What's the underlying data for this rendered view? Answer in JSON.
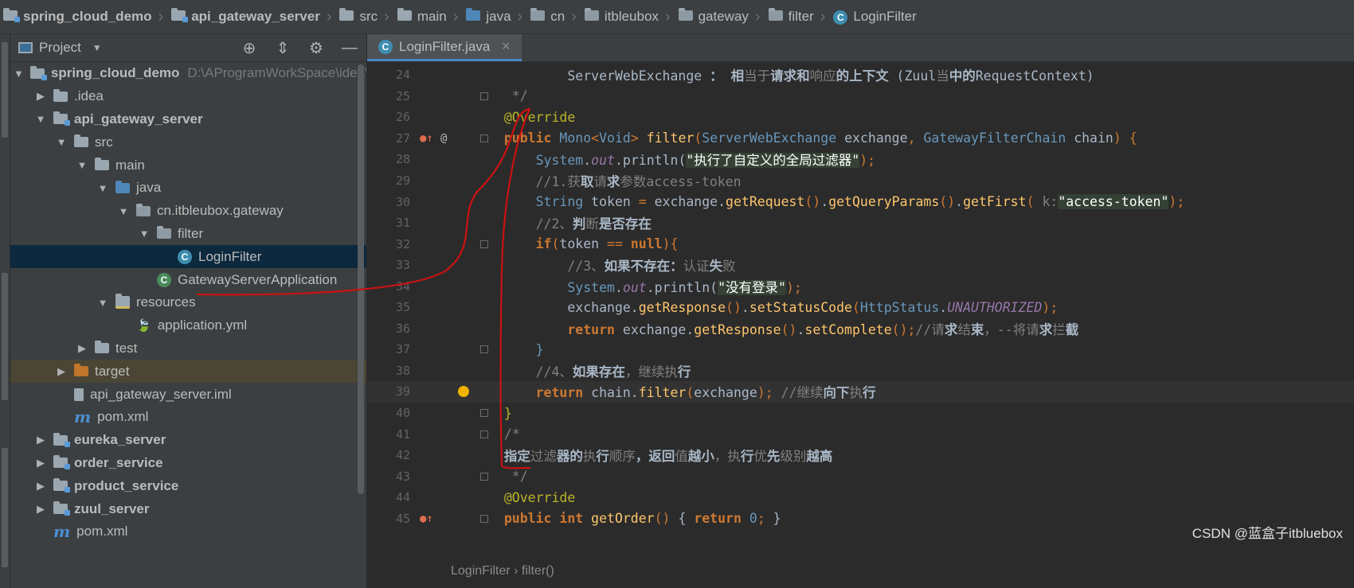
{
  "breadcrumbs": [
    {
      "label": "spring_cloud_demo",
      "icon": "folder-module-icon",
      "bold": true
    },
    {
      "label": "api_gateway_server",
      "icon": "folder-module-icon",
      "bold": true
    },
    {
      "label": "src",
      "icon": "folder-icon"
    },
    {
      "label": "main",
      "icon": "folder-icon"
    },
    {
      "label": "java",
      "icon": "source-folder-icon"
    },
    {
      "label": "cn",
      "icon": "package-icon"
    },
    {
      "label": "itbleubox",
      "icon": "package-icon"
    },
    {
      "label": "gateway",
      "icon": "package-icon"
    },
    {
      "label": "filter",
      "icon": "package-icon"
    },
    {
      "label": "LoginFilter",
      "icon": "class-icon"
    }
  ],
  "project_panel": {
    "title": "Project",
    "tree": [
      {
        "label": "spring_cloud_demo",
        "hint": "D:\\AProgramWorkSpace\\idea\\s",
        "indent": 0,
        "expanded": true,
        "icon": "folder-module-icon",
        "bold": true
      },
      {
        "label": ".idea",
        "indent": 1,
        "expanded": false,
        "icon": "folder-icon"
      },
      {
        "label": "api_gateway_server",
        "indent": 1,
        "expanded": true,
        "icon": "folder-module-icon",
        "bold": true
      },
      {
        "label": "src",
        "indent": 2,
        "expanded": true,
        "icon": "folder-icon"
      },
      {
        "label": "main",
        "indent": 3,
        "expanded": true,
        "icon": "folder-icon"
      },
      {
        "label": "java",
        "indent": 4,
        "expanded": true,
        "icon": "source-folder-icon"
      },
      {
        "label": "cn.itbleubox.gateway",
        "indent": 5,
        "expanded": true,
        "icon": "package-icon"
      },
      {
        "label": "filter",
        "indent": 6,
        "expanded": true,
        "icon": "package-icon"
      },
      {
        "label": "LoginFilter",
        "indent": 7,
        "icon": "class-icon",
        "selected": true
      },
      {
        "label": "GatewayServerApplication",
        "indent": 6,
        "icon": "spring-class-icon"
      },
      {
        "label": "resources",
        "indent": 4,
        "expanded": true,
        "icon": "resources-folder-icon"
      },
      {
        "label": "application.yml",
        "indent": 5,
        "icon": "yaml-icon"
      },
      {
        "label": "test",
        "indent": 3,
        "expanded": false,
        "icon": "folder-icon"
      },
      {
        "label": "target",
        "indent": 2,
        "expanded": false,
        "icon": "excluded-folder-icon",
        "excluded": true
      },
      {
        "label": "api_gateway_server.iml",
        "indent": 2,
        "icon": "iml-file-icon"
      },
      {
        "label": "pom.xml",
        "indent": 2,
        "icon": "maven-icon"
      },
      {
        "label": "eureka_server",
        "indent": 1,
        "expanded": false,
        "icon": "folder-module-icon",
        "bold": true
      },
      {
        "label": "order_service",
        "indent": 1,
        "expanded": false,
        "icon": "folder-module-icon",
        "bold": true
      },
      {
        "label": "product_service",
        "indent": 1,
        "expanded": false,
        "icon": "folder-module-icon",
        "bold": true
      },
      {
        "label": "zuul_server",
        "indent": 1,
        "expanded": false,
        "icon": "folder-module-icon",
        "bold": true
      },
      {
        "label": "pom.xml",
        "indent": 1,
        "icon": "maven-icon"
      }
    ]
  },
  "editor": {
    "tab_label": "LoginFilter.java",
    "current_line": 39,
    "lines": [
      {
        "n": 24,
        "tokens": [
          [
            "pm",
            "          ServerWebExchange "
          ],
          [
            "cj",
            "："
          ],
          [
            "cj",
            " 相"
          ],
          [
            "cm",
            "当于"
          ],
          [
            "cj",
            "请求和"
          ],
          [
            "cm",
            "响应"
          ],
          [
            "cj",
            "的上下文"
          ],
          [
            "pm",
            " (Zuul"
          ],
          [
            "cm",
            "当"
          ],
          [
            "cj",
            "中的"
          ],
          [
            "pm",
            "RequestContext)"
          ]
        ]
      },
      {
        "n": 25,
        "tokens": [
          [
            "cm",
            "   */"
          ]
        ]
      },
      {
        "n": 26,
        "tokens": [
          [
            "an",
            "  @Override"
          ]
        ]
      },
      {
        "n": 27,
        "tokens": [
          [
            "kw",
            "  public "
          ],
          [
            "tp",
            "Mono"
          ],
          [
            "kwn",
            "<"
          ],
          [
            "tp",
            "Void"
          ],
          [
            "kwn",
            "> "
          ],
          [
            "fn",
            "filter"
          ],
          [
            "kwn",
            "("
          ],
          [
            "tp",
            "ServerWebExchange "
          ],
          [
            "pm",
            "exchange"
          ],
          [
            "kwn",
            ", "
          ],
          [
            "tp",
            "GatewayFilterChain "
          ],
          [
            "pm",
            "chain"
          ],
          [
            "kwn",
            ") {"
          ]
        ]
      },
      {
        "n": 28,
        "tokens": [
          [
            "tp",
            "      System"
          ],
          [
            "pm",
            "."
          ],
          [
            "fld",
            "out"
          ],
          [
            "pm",
            ".println("
          ],
          [
            "hs",
            "\"执行了自定义的全局过滤器\""
          ],
          [
            "kwn",
            ");"
          ]
        ]
      },
      {
        "n": 29,
        "tokens": [
          [
            "cm",
            "      //1."
          ],
          [
            "cm",
            "获"
          ],
          [
            "cj",
            "取"
          ],
          [
            "cm",
            "请"
          ],
          [
            "cj",
            "求"
          ],
          [
            "cm",
            "参数access-token"
          ]
        ]
      },
      {
        "n": 30,
        "tokens": [
          [
            "tp",
            "      String "
          ],
          [
            "pm",
            "token "
          ],
          [
            "kwn",
            "= "
          ],
          [
            "pm",
            "exchange."
          ],
          [
            "fn",
            "getRequest"
          ],
          [
            "kwn",
            "()"
          ],
          [
            "pm",
            "."
          ],
          [
            "fn",
            "getQueryParams"
          ],
          [
            "kwn",
            "()"
          ],
          [
            "pm",
            "."
          ],
          [
            "fn",
            "getFirst"
          ],
          [
            "kwn",
            "( "
          ],
          [
            "cm",
            "k:"
          ],
          [
            "hs",
            "\"access-token\""
          ],
          [
            "kwn",
            ");"
          ]
        ]
      },
      {
        "n": 31,
        "tokens": [
          [
            "cm",
            "      //2、"
          ],
          [
            "cj",
            "判"
          ],
          [
            "cm",
            "断"
          ],
          [
            "cj",
            "是否存在"
          ]
        ]
      },
      {
        "n": 32,
        "tokens": [
          [
            "kw",
            "      if"
          ],
          [
            "kwn",
            "("
          ],
          [
            "pm",
            "token "
          ],
          [
            "kwn",
            "== "
          ],
          [
            "kw",
            "null"
          ],
          [
            "kwn",
            "){"
          ]
        ]
      },
      {
        "n": 33,
        "tokens": [
          [
            "cm",
            "          //3、"
          ],
          [
            "cj",
            "如果不存在："
          ],
          [
            "cm",
            "认证"
          ],
          [
            "cj",
            "失"
          ],
          [
            "cm",
            "败"
          ]
        ]
      },
      {
        "n": 34,
        "tokens": [
          [
            "tp",
            "          System"
          ],
          [
            "pm",
            "."
          ],
          [
            "fld",
            "out"
          ],
          [
            "pm",
            ".println("
          ],
          [
            "hs",
            "\"没有登录\""
          ],
          [
            "kwn",
            ");"
          ]
        ]
      },
      {
        "n": 35,
        "tokens": [
          [
            "pm",
            "          exchange."
          ],
          [
            "fn",
            "getResponse"
          ],
          [
            "kwn",
            "()"
          ],
          [
            "pm",
            "."
          ],
          [
            "fn",
            "setStatusCode"
          ],
          [
            "kwn",
            "("
          ],
          [
            "tp",
            "HttpStatus"
          ],
          [
            "pm",
            "."
          ],
          [
            "fld",
            "UNAUTHORIZED"
          ],
          [
            "kwn",
            ");"
          ]
        ]
      },
      {
        "n": 36,
        "tokens": [
          [
            "kw",
            "          return "
          ],
          [
            "pm",
            "exchange."
          ],
          [
            "fn",
            "getResponse"
          ],
          [
            "kwn",
            "()"
          ],
          [
            "pm",
            "."
          ],
          [
            "fn",
            "setComplete"
          ],
          [
            "kwn",
            "();"
          ],
          [
            "cm",
            "//请"
          ],
          [
            "cj",
            "求"
          ],
          [
            "cm",
            "结"
          ],
          [
            "cj",
            "束"
          ],
          [
            "cm",
            "，--将请"
          ],
          [
            "cj",
            "求"
          ],
          [
            "cm",
            "拦"
          ],
          [
            "cj",
            "截"
          ]
        ]
      },
      {
        "n": 37,
        "tokens": [
          [
            "tp",
            "      }"
          ]
        ]
      },
      {
        "n": 38,
        "tokens": [
          [
            "cm",
            "      //4、"
          ],
          [
            "cj",
            "如果存在"
          ],
          [
            "cm",
            "，继续执"
          ],
          [
            "cj",
            "行"
          ]
        ]
      },
      {
        "n": 39,
        "tokens": [
          [
            "kw",
            "      return "
          ],
          [
            "pm",
            "chain."
          ],
          [
            "fn",
            "filter"
          ],
          [
            "kwn",
            "("
          ],
          [
            "pm",
            "exchange"
          ],
          [
            "kwn",
            "); "
          ],
          [
            "cm",
            "//继续"
          ],
          [
            "cj",
            "向下"
          ],
          [
            "cm",
            "执"
          ],
          [
            "cj",
            "行"
          ]
        ]
      },
      {
        "n": 40,
        "tokens": [
          [
            "an",
            "  }"
          ]
        ]
      },
      {
        "n": 41,
        "tokens": [
          [
            "cm",
            "  /*"
          ]
        ]
      },
      {
        "n": 42,
        "tokens": [
          [
            "cj",
            "  指定"
          ],
          [
            "cm",
            "过滤"
          ],
          [
            "cj",
            "器的"
          ],
          [
            "cm",
            "执"
          ],
          [
            "cj",
            "行"
          ],
          [
            "cm",
            "顺序"
          ],
          [
            "cj",
            "，返回"
          ],
          [
            "cm",
            "值"
          ],
          [
            "cj",
            "越小"
          ],
          [
            "cm",
            "，执"
          ],
          [
            "cj",
            "行"
          ],
          [
            "cm",
            "优"
          ],
          [
            "cj",
            "先"
          ],
          [
            "cm",
            "级别"
          ],
          [
            "cj",
            "越高"
          ]
        ]
      },
      {
        "n": 43,
        "tokens": [
          [
            "cm",
            "   */"
          ]
        ]
      },
      {
        "n": 44,
        "tokens": [
          [
            "an",
            "  @Override"
          ]
        ]
      },
      {
        "n": 45,
        "tokens": [
          [
            "kw",
            "  public int "
          ],
          [
            "fn",
            "getOrder"
          ],
          [
            "kwn",
            "() "
          ],
          [
            "pm",
            "{ "
          ],
          [
            "kw",
            "return "
          ],
          [
            "tp",
            "0"
          ],
          [
            "kwn",
            "; "
          ],
          [
            "pm",
            "}"
          ]
        ]
      }
    ],
    "bottom_breadcrumb": "LoginFilter  ›  filter()"
  },
  "watermark": "CSDN @蓝盒子itbluebox",
  "colors": {
    "keyword": "#cc7832",
    "type": "#6897bb",
    "function": "#ffc66d",
    "comment": "#808080",
    "annotation": "#bbb529",
    "string": "#6a8759",
    "field": "#9876aa",
    "annotation_ink": "#cc1111"
  }
}
